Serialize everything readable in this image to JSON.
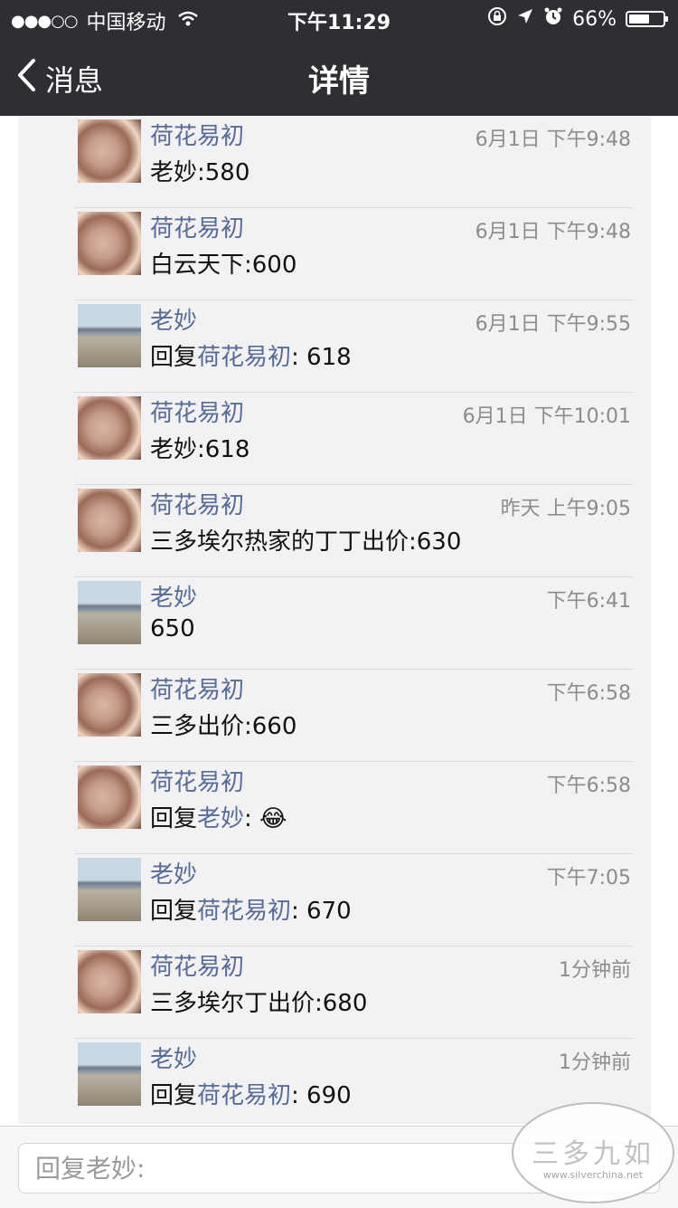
{
  "status_bar": {
    "signal": "●●●○○",
    "carrier": "中国移动",
    "time": "下午11:29",
    "battery": "66%",
    "battery_level": 0.66
  },
  "nav": {
    "back_label": "消息",
    "title": "详情"
  },
  "comments": [
    {
      "name": "荷花易初",
      "time": "6月1日 下午9:48",
      "avatar": "coin",
      "prefix": "",
      "mention": "",
      "text": "老妙:580"
    },
    {
      "name": "荷花易初",
      "time": "6月1日 下午9:48",
      "avatar": "coin",
      "prefix": "",
      "mention": "",
      "text": "白云天下:600"
    },
    {
      "name": "老妙",
      "time": "6月1日 下午9:55",
      "avatar": "landscape",
      "prefix": "回复",
      "mention": "荷花易初",
      "text": ": 618"
    },
    {
      "name": "荷花易初",
      "time": "6月1日 下午10:01",
      "avatar": "coin",
      "prefix": "",
      "mention": "",
      "text": "老妙:618"
    },
    {
      "name": "荷花易初",
      "time": "昨天 上午9:05",
      "avatar": "coin",
      "prefix": "",
      "mention": "",
      "text": "三多埃尔热家的丁丁出价:630"
    },
    {
      "name": "老妙",
      "time": "下午6:41",
      "avatar": "landscape",
      "prefix": "",
      "mention": "",
      "text": "650"
    },
    {
      "name": "荷花易初",
      "time": "下午6:58",
      "avatar": "coin",
      "prefix": "",
      "mention": "",
      "text": "三多出价:660"
    },
    {
      "name": "荷花易初",
      "time": "下午6:58",
      "avatar": "coin",
      "prefix": "回复",
      "mention": "老妙",
      "text": ": 😂"
    },
    {
      "name": "老妙",
      "time": "下午7:05",
      "avatar": "landscape",
      "prefix": "回复",
      "mention": "荷花易初",
      "text": ": 670"
    },
    {
      "name": "荷花易初",
      "time": "1分钟前",
      "avatar": "coin",
      "prefix": "",
      "mention": "",
      "text": "三多埃尔丁出价:680"
    },
    {
      "name": "老妙",
      "time": "1分钟前",
      "avatar": "landscape",
      "prefix": "回复",
      "mention": "荷花易初",
      "text": ": 690"
    }
  ],
  "reply_input": {
    "placeholder": "回复老妙:"
  },
  "watermark": {
    "title": "三多九如",
    "url": "www.silverchina.net"
  },
  "colors": {
    "nav_bg": "#2e2e33",
    "name_blue": "#586b94",
    "content_bg": "#f2f2f4"
  }
}
